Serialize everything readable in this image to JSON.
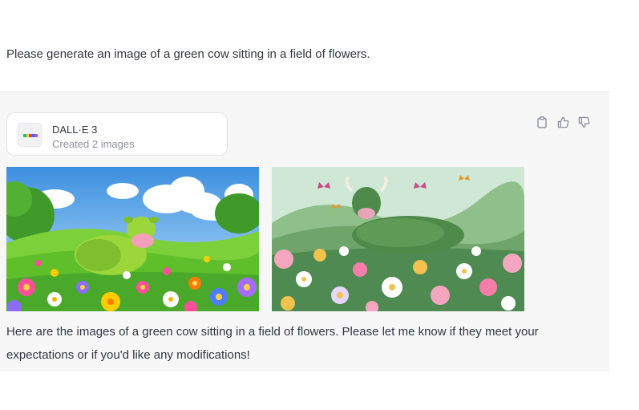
{
  "user_message": {
    "text": "Please generate an image of a green cow sitting in a field of flowers."
  },
  "assistant": {
    "tool": {
      "name": "DALL·E 3",
      "status": "Created 2 images",
      "logo_colors": [
        "#19c37d",
        "#ffcc00",
        "#ff3b30",
        "#2f6bff",
        "#a855f7"
      ]
    },
    "actions": [
      {
        "icon": "clipboard-icon"
      },
      {
        "icon": "thumbs-up-icon"
      },
      {
        "icon": "thumbs-down-icon"
      }
    ],
    "images": [
      {
        "subject": "green cow in flower field, bright sky"
      },
      {
        "subject": "green cow with horns in flower field, butterflies"
      }
    ],
    "reply": "Here are the images of a green cow sitting in a field of flowers. Please let me know if they meet your expectations or if you'd like any modifications!"
  },
  "colors": {
    "text": "#343541",
    "muted": "#8e8ea0",
    "assistant_bg": "#f7f7f8",
    "border": "#e3e3e8"
  }
}
